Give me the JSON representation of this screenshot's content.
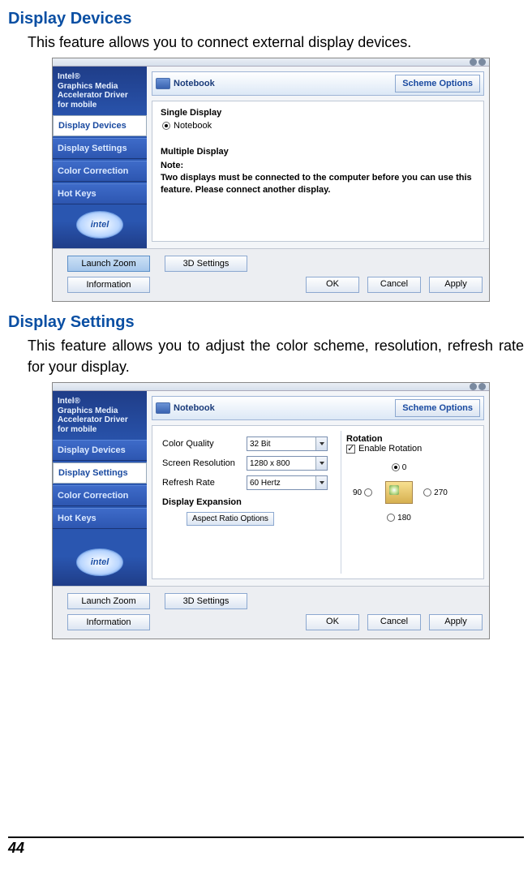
{
  "section1": {
    "title": "Display Devices",
    "desc": "This feature allows you to connect external display devices."
  },
  "section2": {
    "title": "Display Settings",
    "desc": "This feature allows you to adjust the color scheme, resolution, refresh rate for your display."
  },
  "sidebar": {
    "title": "Intel®\nGraphics Media\nAccelerator Driver\nfor mobile",
    "tabs": [
      "Display Devices",
      "Display Settings",
      "Color Correction",
      "Hot Keys"
    ],
    "logo": "intel"
  },
  "deviceBar": {
    "label": "Notebook",
    "schemeBtn": "Scheme Options"
  },
  "panel1": {
    "singleTitle": "Single Display",
    "singleOpt": "Notebook",
    "multiTitle": "Multiple Display",
    "noteLabel": "Note:",
    "noteText": "Two displays must be connected to the computer before you can use this feature.  Please connect another display."
  },
  "panel2": {
    "rows": {
      "colorQualityLabel": "Color Quality",
      "colorQualityValue": "32 Bit",
      "screenResLabel": "Screen Resolution",
      "screenResValue": "1280 x 800",
      "refreshLabel": "Refresh Rate",
      "refreshValue": "60 Hertz"
    },
    "expansionTitle": "Display Expansion",
    "aspectBtn": "Aspect Ratio Options",
    "rotation": {
      "title": "Rotation",
      "enableLabel": "Enable Rotation",
      "deg0": "0",
      "deg90": "90",
      "deg180": "180",
      "deg270": "270"
    }
  },
  "footer": {
    "launchZoom": "Launch Zoom",
    "settings3d": "3D Settings",
    "information": "Information",
    "ok": "OK",
    "cancel": "Cancel",
    "apply": "Apply"
  },
  "pageNumber": "44"
}
